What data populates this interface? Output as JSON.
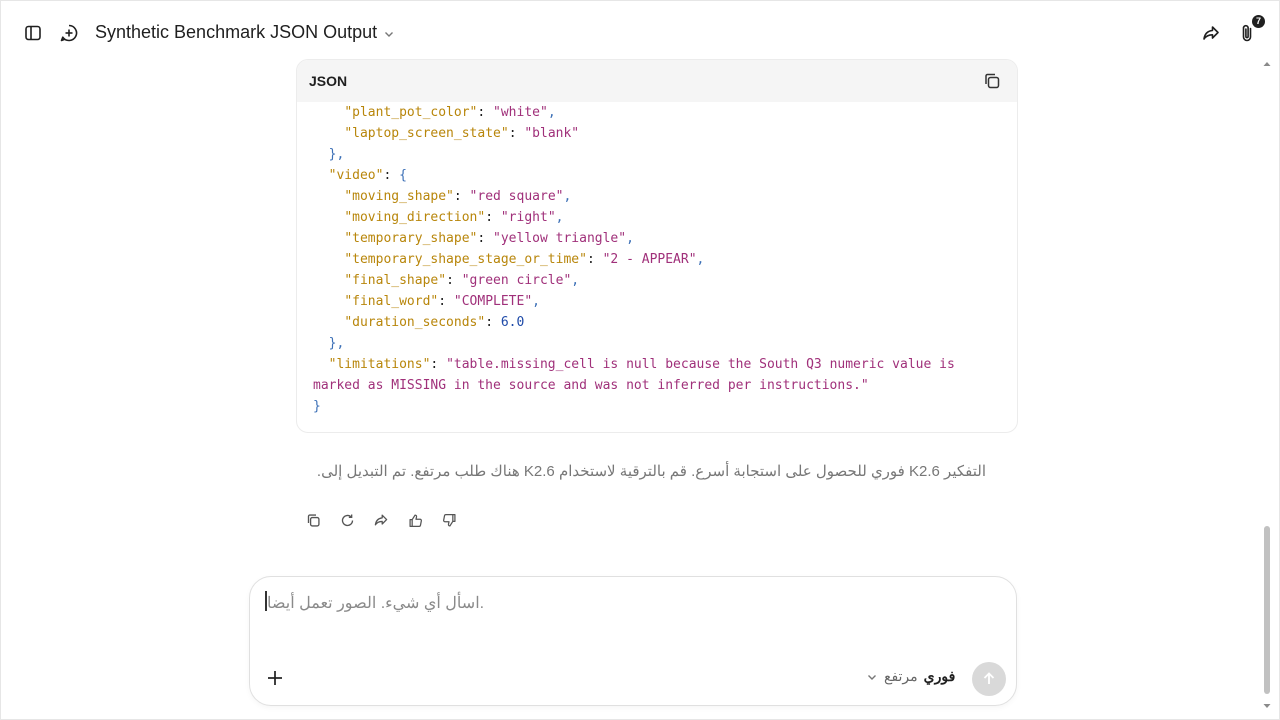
{
  "header": {
    "title": "Synthetic Benchmark JSON Output",
    "attachment_count": "7"
  },
  "code_block": {
    "language": "JSON",
    "lines": [
      [
        {
          "t": "    "
        },
        {
          "c": "k",
          "t": "\"plant_pot_color\""
        },
        {
          "t": ": "
        },
        {
          "c": "s",
          "t": "\"white\""
        },
        {
          "c": "p",
          "t": ","
        }
      ],
      [
        {
          "t": "    "
        },
        {
          "c": "k",
          "t": "\"laptop_screen_state\""
        },
        {
          "t": ": "
        },
        {
          "c": "s",
          "t": "\"blank\""
        }
      ],
      [
        {
          "t": "  "
        },
        {
          "c": "p",
          "t": "},"
        }
      ],
      [
        {
          "t": "  "
        },
        {
          "c": "k",
          "t": "\"video\""
        },
        {
          "t": ": "
        },
        {
          "c": "p",
          "t": "{"
        }
      ],
      [
        {
          "t": "    "
        },
        {
          "c": "k",
          "t": "\"moving_shape\""
        },
        {
          "t": ": "
        },
        {
          "c": "s",
          "t": "\"red square\""
        },
        {
          "c": "p",
          "t": ","
        }
      ],
      [
        {
          "t": "    "
        },
        {
          "c": "k",
          "t": "\"moving_direction\""
        },
        {
          "t": ": "
        },
        {
          "c": "s",
          "t": "\"right\""
        },
        {
          "c": "p",
          "t": ","
        }
      ],
      [
        {
          "t": "    "
        },
        {
          "c": "k",
          "t": "\"temporary_shape\""
        },
        {
          "t": ": "
        },
        {
          "c": "s",
          "t": "\"yellow triangle\""
        },
        {
          "c": "p",
          "t": ","
        }
      ],
      [
        {
          "t": "    "
        },
        {
          "c": "k",
          "t": "\"temporary_shape_stage_or_time\""
        },
        {
          "t": ": "
        },
        {
          "c": "s",
          "t": "\"2 - APPEAR\""
        },
        {
          "c": "p",
          "t": ","
        }
      ],
      [
        {
          "t": "    "
        },
        {
          "c": "k",
          "t": "\"final_shape\""
        },
        {
          "t": ": "
        },
        {
          "c": "s",
          "t": "\"green circle\""
        },
        {
          "c": "p",
          "t": ","
        }
      ],
      [
        {
          "t": "    "
        },
        {
          "c": "k",
          "t": "\"final_word\""
        },
        {
          "t": ": "
        },
        {
          "c": "s",
          "t": "\"COMPLETE\""
        },
        {
          "c": "p",
          "t": ","
        }
      ],
      [
        {
          "t": "    "
        },
        {
          "c": "k",
          "t": "\"duration_seconds\""
        },
        {
          "t": ": "
        },
        {
          "c": "n",
          "t": "6.0"
        }
      ],
      [
        {
          "t": "  "
        },
        {
          "c": "p",
          "t": "},"
        }
      ],
      [
        {
          "t": "  "
        },
        {
          "c": "k",
          "t": "\"limitations\""
        },
        {
          "t": ": "
        },
        {
          "c": "s",
          "t": "\"table.missing_cell is null because the South Q3 numeric value is"
        }
      ],
      [
        {
          "c": "s",
          "t": "marked as MISSING in the source and was not inferred per instructions.\""
        }
      ],
      [
        {
          "c": "p",
          "t": "}"
        }
      ]
    ]
  },
  "notice": "التفكير K2.6 فوري للحصول على استجابة أسرع. قم بالترقية لاستخدام K2.6 هناك طلب مرتفع. تم التبديل إلى.",
  "composer": {
    "placeholder": "اسأل أي شيء. الصور تعمل أيضا.",
    "mode_primary": "فوري",
    "mode_secondary": "مرتفع"
  },
  "icons": {
    "sidebar": "sidebar-toggle-icon",
    "new_chat": "new-chat-icon",
    "share": "share-icon",
    "attachment": "paperclip-icon",
    "copy": "copy-icon",
    "regenerate": "refresh-icon",
    "forward": "share-icon",
    "like": "thumbs-up-icon",
    "dislike": "thumbs-down-icon",
    "add": "plus-icon",
    "send": "arrow-up-icon"
  }
}
